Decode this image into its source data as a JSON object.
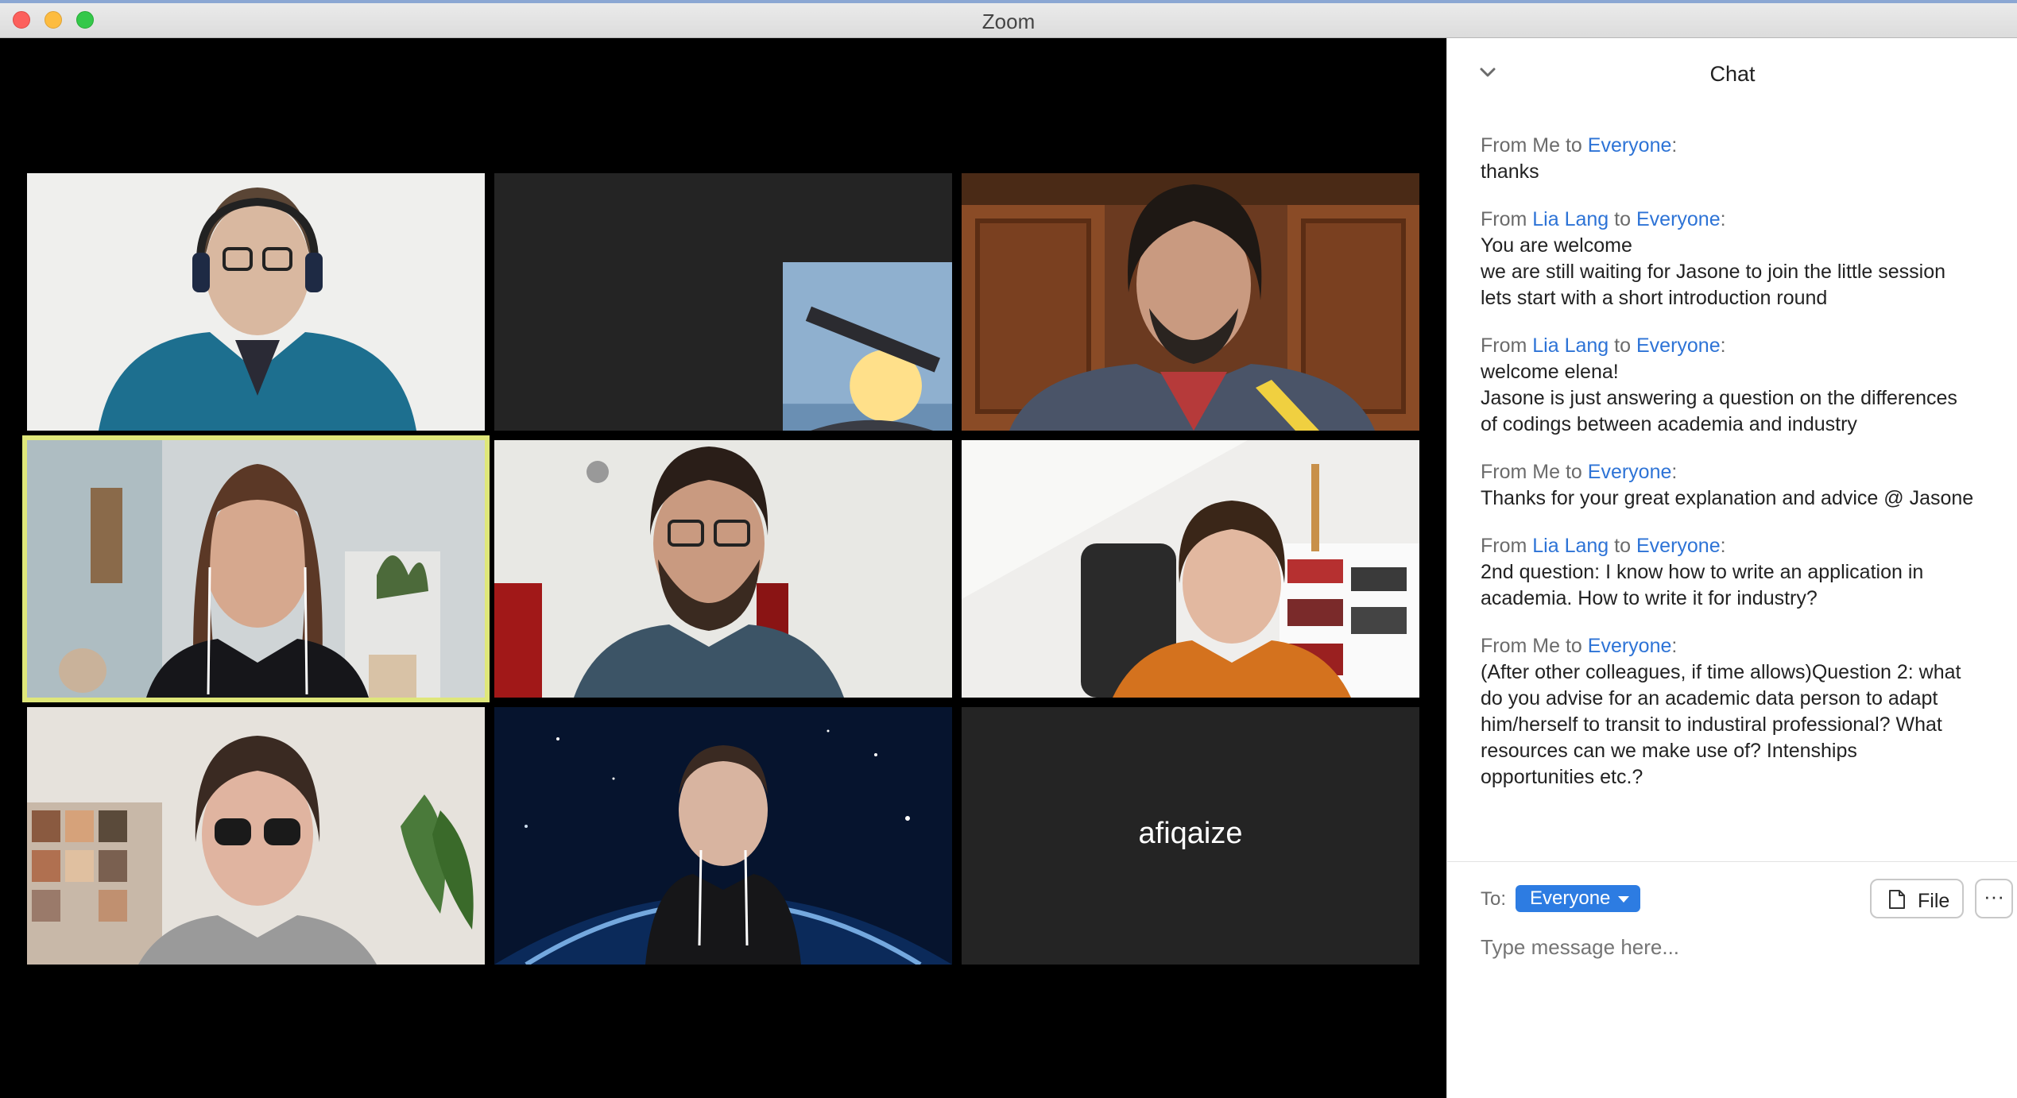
{
  "window": {
    "title": "Zoom"
  },
  "participants": [
    {
      "id": "p1"
    },
    {
      "id": "p2"
    },
    {
      "id": "p3"
    },
    {
      "id": "p4"
    },
    {
      "id": "p5"
    },
    {
      "id": "p6"
    },
    {
      "id": "p7"
    },
    {
      "id": "p8"
    },
    {
      "id": "p9",
      "name": "afiqaize"
    }
  ],
  "active_speaker": "p4",
  "chat": {
    "title": "Chat",
    "messages": [
      {
        "from": "Me",
        "to": "Everyone",
        "lines": [
          "thanks"
        ]
      },
      {
        "from": "Lia Lang",
        "to": "Everyone",
        "lines": [
          "You are welcome",
          "we are still waiting for Jasone to join the little session",
          "lets start with a short introduction round"
        ]
      },
      {
        "from": "Lia Lang",
        "to": "Everyone",
        "lines": [
          "welcome elena!",
          "Jasone is just answering a question on the differences",
          "of codings between academia and industry"
        ]
      },
      {
        "from": "Me",
        "to": "Everyone",
        "lines": [
          "Thanks for your great explanation and advice @ Jasone"
        ]
      },
      {
        "from": "Lia Lang",
        "to": "Everyone",
        "lines": [
          "2nd question: I know how to write an application in",
          "academia. How to write it for industry?"
        ]
      },
      {
        "from": "Me",
        "to": "Everyone",
        "lines": [
          "(After other colleagues, if time allows)Question 2: what",
          "do you advise for an academic data person to adapt",
          "him/herself to transit to industiral professional? What",
          "resources can we make use of? Intenships",
          "opportunities etc.?"
        ]
      }
    ],
    "labels": {
      "from": "From",
      "to_word": "to",
      "colon": ":"
    },
    "to_label": "To:",
    "to_value": "Everyone",
    "file_button": "File",
    "more_button": "···",
    "input_placeholder": "Type message here...",
    "colors": {
      "accent": "#2d7ce2",
      "link": "#2d73d6"
    }
  },
  "icons": {
    "collapse": "chevron-down-icon",
    "file": "document-icon",
    "more": "ellipsis-icon",
    "to_dropdown": "caret-down-icon"
  }
}
